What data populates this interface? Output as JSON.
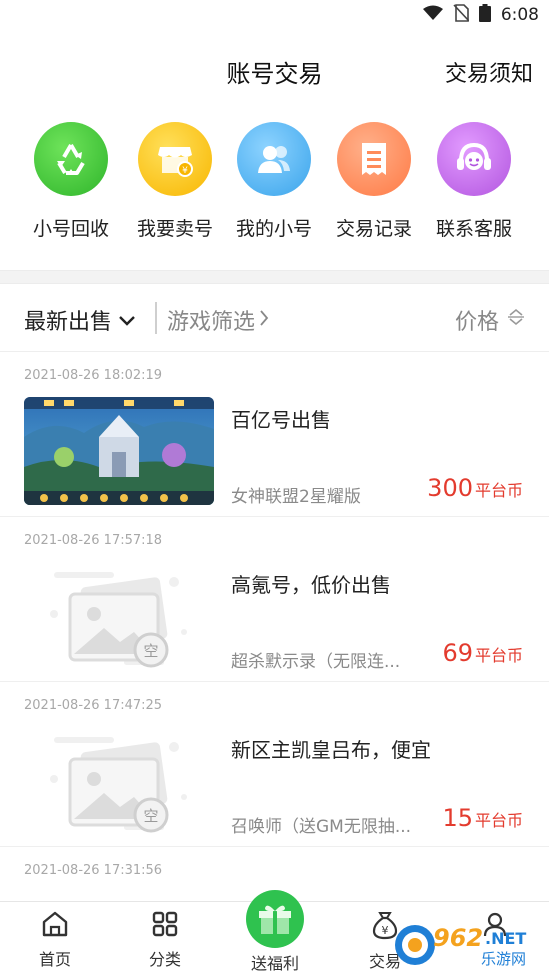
{
  "status_bar": {
    "time": "6:08"
  },
  "header": {
    "title": "账号交易",
    "notice": "交易须知"
  },
  "quick_actions": [
    {
      "label": "小号回收",
      "color": "#3fc93c",
      "icon": "recycle-icon"
    },
    {
      "label": "我要卖号",
      "color": "#ffc21a",
      "icon": "shop-icon"
    },
    {
      "label": "我的小号",
      "color": "#4bb2ef",
      "icon": "users-icon"
    },
    {
      "label": "交易记录",
      "color": "#ff8c5a",
      "icon": "receipt-icon"
    },
    {
      "label": "联系客服",
      "color": "#c970e8",
      "icon": "headset-icon"
    }
  ],
  "filter": {
    "latest": "最新出售",
    "game_filter": "游戏筛选",
    "price": "价格"
  },
  "listings": [
    {
      "time": "2021-08-26 18:02:19",
      "title": "百亿号出售",
      "game": "女神联盟2星耀版",
      "price": "300",
      "unit": "平台币"
    },
    {
      "time": "2021-08-26 17:57:18",
      "title": "高氪号，低价出售",
      "game": "超杀默示录（无限连...",
      "price": "69",
      "unit": "平台币"
    },
    {
      "time": "2021-08-26 17:47:25",
      "title": "新区主凯皇吕布，便宜",
      "game": "召唤师（送GM无限抽...",
      "price": "15",
      "unit": "平台币"
    },
    {
      "time": "2021-08-26 17:31:56"
    }
  ],
  "placeholder_text": "空",
  "bottom_nav": {
    "home": "首页",
    "category": "分类",
    "welfare": "送福利",
    "trade": "交易"
  },
  "watermark": "962.NET 乐游网",
  "colors": {
    "price": "#e33b2e",
    "accent_green": "#2fc24f"
  }
}
